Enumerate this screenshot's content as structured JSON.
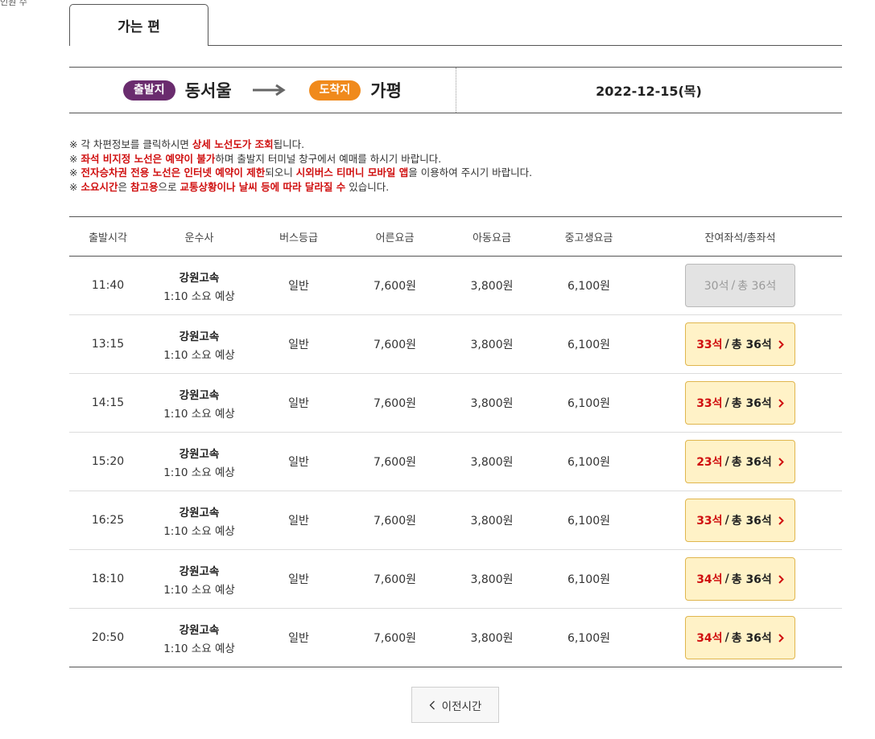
{
  "corner_text": "인원 수",
  "tab": {
    "label": "가는 편"
  },
  "route": {
    "depart_label": "출발지",
    "depart_city": "동서울",
    "arrive_label": "도착지",
    "arrive_city": "가평",
    "date": "2022-12-15(목)"
  },
  "notices": [
    [
      "※ 각 차편정보를 클릭하시면 ",
      "상세 노선도가 조회",
      "됩니다."
    ],
    [
      "※ ",
      "좌석 비지정 노선은 예약이 불가",
      "하며 출발지 터미널 창구에서 예매를 하시기 바랍니다."
    ],
    [
      "※ ",
      "전자승차권 전용 노선은 인터넷 예약이 제한",
      "되오니 ",
      "시외버스 티머니 모바일 앱",
      "을 이용하여 주시기 바랍니다."
    ],
    [
      "※ ",
      "소요시간",
      "은 ",
      "참고용",
      "으로 ",
      "교통상황이나 날씨 등에 따라 달라질 수",
      " 있습니다."
    ]
  ],
  "table": {
    "headers": [
      "출발시각",
      "운수사",
      "버스등급",
      "어른요금",
      "아동요금",
      "중고생요금",
      "잔여좌석/총좌석"
    ],
    "rows": [
      {
        "time": "11:40",
        "company": "강원고속",
        "duration": "1:10 소요 예상",
        "grade": "일반",
        "adult": "7,600원",
        "child": "3,800원",
        "youth": "6,100원",
        "remain": "30석",
        "total": "총 36석",
        "available": false
      },
      {
        "time": "13:15",
        "company": "강원고속",
        "duration": "1:10 소요 예상",
        "grade": "일반",
        "adult": "7,600원",
        "child": "3,800원",
        "youth": "6,100원",
        "remain": "33석",
        "total": "총 36석",
        "available": true
      },
      {
        "time": "14:15",
        "company": "강원고속",
        "duration": "1:10 소요 예상",
        "grade": "일반",
        "adult": "7,600원",
        "child": "3,800원",
        "youth": "6,100원",
        "remain": "33석",
        "total": "총 36석",
        "available": true
      },
      {
        "time": "15:20",
        "company": "강원고속",
        "duration": "1:10 소요 예상",
        "grade": "일반",
        "adult": "7,600원",
        "child": "3,800원",
        "youth": "6,100원",
        "remain": "23석",
        "total": "총 36석",
        "available": true
      },
      {
        "time": "16:25",
        "company": "강원고속",
        "duration": "1:10 소요 예상",
        "grade": "일반",
        "adult": "7,600원",
        "child": "3,800원",
        "youth": "6,100원",
        "remain": "33석",
        "total": "총 36석",
        "available": true
      },
      {
        "time": "18:10",
        "company": "강원고속",
        "duration": "1:10 소요 예상",
        "grade": "일반",
        "adult": "7,600원",
        "child": "3,800원",
        "youth": "6,100원",
        "remain": "34석",
        "total": "총 36석",
        "available": true
      },
      {
        "time": "20:50",
        "company": "강원고속",
        "duration": "1:10 소요 예상",
        "grade": "일반",
        "adult": "7,600원",
        "child": "3,800원",
        "youth": "6,100원",
        "remain": "34석",
        "total": "총 36석",
        "available": true
      }
    ]
  },
  "prev_button": {
    "label": "이전시간",
    "icon": "chevron-left-icon"
  },
  "colors": {
    "depart": "#6a2c6e",
    "arrive": "#f08a1c",
    "highlight": "#d01010",
    "seat_bg": "#fff2c7"
  }
}
